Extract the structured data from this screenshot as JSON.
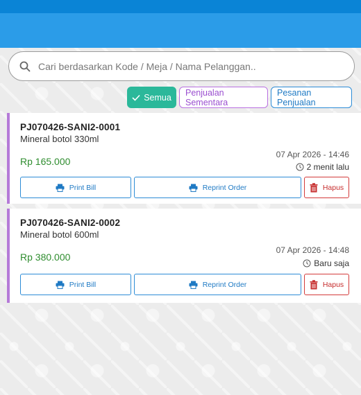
{
  "search": {
    "placeholder": "Cari berdasarkan Kode / Meja / Nama Pelanggan.."
  },
  "filters": {
    "all_label": "Semua",
    "temp_label": "Penjualan Sementara",
    "orders_label": "Pesanan Penjualan"
  },
  "colors": {
    "header": "#2b9ce8",
    "statusbar": "#0a84d6",
    "accent_green": "#2bb89a",
    "accent_purple": "#b57ad8",
    "price_green": "#2f8d2f",
    "delete_red": "#d33a3a"
  },
  "orders": [
    {
      "code": "PJ070426-SANI2-0001",
      "item": "Mineral botol 330ml",
      "price": "Rp 165.000",
      "date": "07 Apr 2026 - 14:46",
      "ago": "2 menit lalu",
      "print_label": "Print Bill",
      "reprint_label": "Reprint Order",
      "delete_label": "Hapus"
    },
    {
      "code": "PJ070426-SANI2-0002",
      "item": "Mineral botol 600ml",
      "price": "Rp 380.000",
      "date": "07 Apr 2026 - 14:48",
      "ago": "Baru saja",
      "print_label": "Print Bill",
      "reprint_label": "Reprint Order",
      "delete_label": "Hapus"
    }
  ],
  "icons": {
    "search": "search-icon",
    "check": "check-icon",
    "clock": "clock-icon",
    "printer": "printer-icon",
    "trash": "trash-icon"
  }
}
